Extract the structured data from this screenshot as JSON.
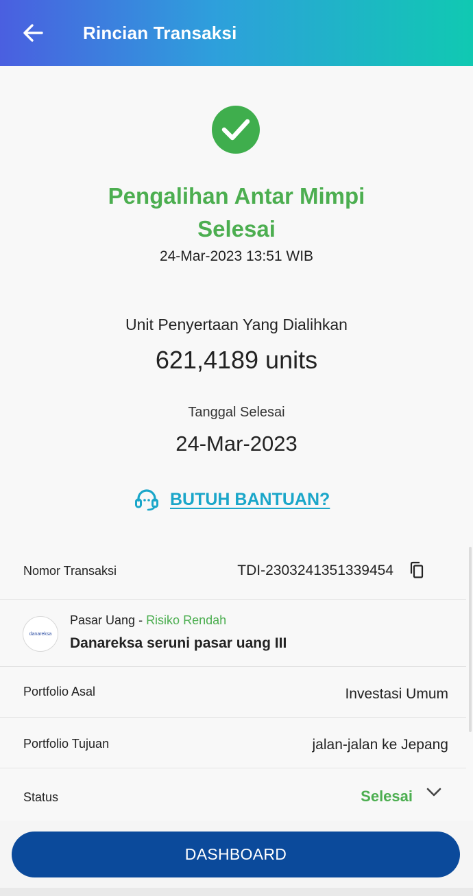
{
  "appbar": {
    "title": "Rincian Transaksi",
    "back_icon": "arrow-left-icon"
  },
  "status_header": {
    "icon": "check-circle-icon",
    "title_line1": "Pengalihan Antar Mimpi",
    "title_line2": "Selesai",
    "datetime": "24-Mar-2023 13:51 WIB"
  },
  "summary": {
    "units_label": "Unit Penyertaan Yang Dialihkan",
    "units_value": "621,4189 units",
    "date_label": "Tanggal Selesai",
    "date_value": "24-Mar-2023"
  },
  "help": {
    "icon": "headset-icon",
    "label": "BUTUH BANTUAN?"
  },
  "details": {
    "transaction_no_label": "Nomor Transaksi",
    "transaction_no_value": "TDI-2303241351339454",
    "copy_icon": "copy-icon",
    "fund_category": "Pasar Uang",
    "fund_separator": " - ",
    "fund_risk": "Risiko Rendah",
    "fund_name": "Danareksa seruni pasar uang III",
    "fund_logo_text": "danareksa",
    "origin_label": "Portfolio Asal",
    "origin_value": "Investasi Umum",
    "target_label": "Portfolio Tujuan",
    "target_value": "jalan-jalan ke Jepang",
    "status_label": "Status",
    "status_value": "Selesai",
    "status_expand_icon": "chevron-down-icon"
  },
  "footer": {
    "dashboard_label": "DASHBOARD"
  },
  "colors": {
    "success_green": "#4cae50",
    "link_teal": "#1aa6c9",
    "primary_blue": "#0b4a9b",
    "header_gradient_start": "#4a5fe0",
    "header_gradient_end": "#10c9b2"
  }
}
